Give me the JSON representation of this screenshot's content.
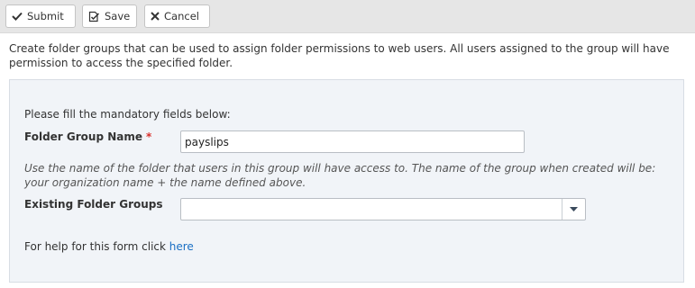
{
  "toolbar": {
    "submit_label": "Submit",
    "save_label": "Save",
    "cancel_label": "Cancel"
  },
  "intro_text": "Create folder groups that can be used to assign folder permissions to web users. All users assigned to the group will have permission to access the specified folder.",
  "form": {
    "instructions": "Please fill the mandatory fields below:",
    "folder_group_name": {
      "label": "Folder Group Name",
      "required_marker": "*",
      "value": "payslips"
    },
    "hint": "Use the name of the folder that users in this group will have access to. The name of the group when created will be: your organization name + the name defined above.",
    "existing_groups": {
      "label": "Existing Folder Groups",
      "selected": ""
    },
    "help": {
      "prefix": "For help for this form click ",
      "link_text": "here"
    }
  },
  "colors": {
    "toolbar_bg": "#e6e6e6",
    "panel_bg": "#f1f4f8",
    "required": "#d9302c",
    "link": "#1a6fc4"
  },
  "icons": {
    "submit": "checkmark-icon",
    "save": "save-edit-icon",
    "cancel": "close-icon",
    "dropdown": "caret-down-icon"
  }
}
